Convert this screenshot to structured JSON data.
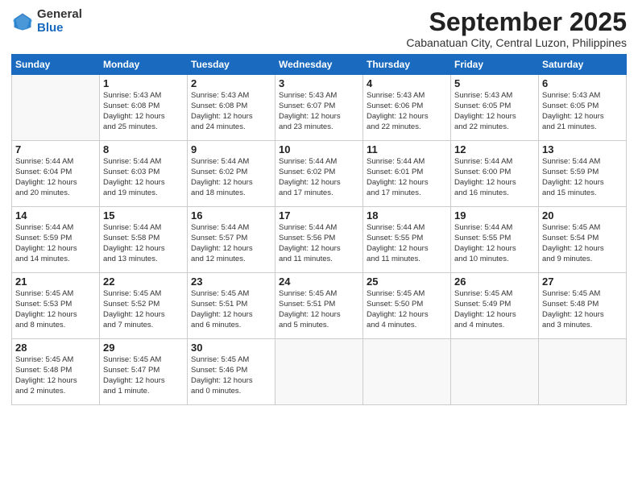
{
  "logo": {
    "general": "General",
    "blue": "Blue"
  },
  "header": {
    "month": "September 2025",
    "location": "Cabanatuan City, Central Luzon, Philippines"
  },
  "weekdays": [
    "Sunday",
    "Monday",
    "Tuesday",
    "Wednesday",
    "Thursday",
    "Friday",
    "Saturday"
  ],
  "weeks": [
    [
      {
        "day": "",
        "info": ""
      },
      {
        "day": "1",
        "info": "Sunrise: 5:43 AM\nSunset: 6:08 PM\nDaylight: 12 hours\nand 25 minutes."
      },
      {
        "day": "2",
        "info": "Sunrise: 5:43 AM\nSunset: 6:08 PM\nDaylight: 12 hours\nand 24 minutes."
      },
      {
        "day": "3",
        "info": "Sunrise: 5:43 AM\nSunset: 6:07 PM\nDaylight: 12 hours\nand 23 minutes."
      },
      {
        "day": "4",
        "info": "Sunrise: 5:43 AM\nSunset: 6:06 PM\nDaylight: 12 hours\nand 22 minutes."
      },
      {
        "day": "5",
        "info": "Sunrise: 5:43 AM\nSunset: 6:05 PM\nDaylight: 12 hours\nand 22 minutes."
      },
      {
        "day": "6",
        "info": "Sunrise: 5:43 AM\nSunset: 6:05 PM\nDaylight: 12 hours\nand 21 minutes."
      }
    ],
    [
      {
        "day": "7",
        "info": "Sunrise: 5:44 AM\nSunset: 6:04 PM\nDaylight: 12 hours\nand 20 minutes."
      },
      {
        "day": "8",
        "info": "Sunrise: 5:44 AM\nSunset: 6:03 PM\nDaylight: 12 hours\nand 19 minutes."
      },
      {
        "day": "9",
        "info": "Sunrise: 5:44 AM\nSunset: 6:02 PM\nDaylight: 12 hours\nand 18 minutes."
      },
      {
        "day": "10",
        "info": "Sunrise: 5:44 AM\nSunset: 6:02 PM\nDaylight: 12 hours\nand 17 minutes."
      },
      {
        "day": "11",
        "info": "Sunrise: 5:44 AM\nSunset: 6:01 PM\nDaylight: 12 hours\nand 17 minutes."
      },
      {
        "day": "12",
        "info": "Sunrise: 5:44 AM\nSunset: 6:00 PM\nDaylight: 12 hours\nand 16 minutes."
      },
      {
        "day": "13",
        "info": "Sunrise: 5:44 AM\nSunset: 5:59 PM\nDaylight: 12 hours\nand 15 minutes."
      }
    ],
    [
      {
        "day": "14",
        "info": "Sunrise: 5:44 AM\nSunset: 5:59 PM\nDaylight: 12 hours\nand 14 minutes."
      },
      {
        "day": "15",
        "info": "Sunrise: 5:44 AM\nSunset: 5:58 PM\nDaylight: 12 hours\nand 13 minutes."
      },
      {
        "day": "16",
        "info": "Sunrise: 5:44 AM\nSunset: 5:57 PM\nDaylight: 12 hours\nand 12 minutes."
      },
      {
        "day": "17",
        "info": "Sunrise: 5:44 AM\nSunset: 5:56 PM\nDaylight: 12 hours\nand 11 minutes."
      },
      {
        "day": "18",
        "info": "Sunrise: 5:44 AM\nSunset: 5:55 PM\nDaylight: 12 hours\nand 11 minutes."
      },
      {
        "day": "19",
        "info": "Sunrise: 5:44 AM\nSunset: 5:55 PM\nDaylight: 12 hours\nand 10 minutes."
      },
      {
        "day": "20",
        "info": "Sunrise: 5:45 AM\nSunset: 5:54 PM\nDaylight: 12 hours\nand 9 minutes."
      }
    ],
    [
      {
        "day": "21",
        "info": "Sunrise: 5:45 AM\nSunset: 5:53 PM\nDaylight: 12 hours\nand 8 minutes."
      },
      {
        "day": "22",
        "info": "Sunrise: 5:45 AM\nSunset: 5:52 PM\nDaylight: 12 hours\nand 7 minutes."
      },
      {
        "day": "23",
        "info": "Sunrise: 5:45 AM\nSunset: 5:51 PM\nDaylight: 12 hours\nand 6 minutes."
      },
      {
        "day": "24",
        "info": "Sunrise: 5:45 AM\nSunset: 5:51 PM\nDaylight: 12 hours\nand 5 minutes."
      },
      {
        "day": "25",
        "info": "Sunrise: 5:45 AM\nSunset: 5:50 PM\nDaylight: 12 hours\nand 4 minutes."
      },
      {
        "day": "26",
        "info": "Sunrise: 5:45 AM\nSunset: 5:49 PM\nDaylight: 12 hours\nand 4 minutes."
      },
      {
        "day": "27",
        "info": "Sunrise: 5:45 AM\nSunset: 5:48 PM\nDaylight: 12 hours\nand 3 minutes."
      }
    ],
    [
      {
        "day": "28",
        "info": "Sunrise: 5:45 AM\nSunset: 5:48 PM\nDaylight: 12 hours\nand 2 minutes."
      },
      {
        "day": "29",
        "info": "Sunrise: 5:45 AM\nSunset: 5:47 PM\nDaylight: 12 hours\nand 1 minute."
      },
      {
        "day": "30",
        "info": "Sunrise: 5:45 AM\nSunset: 5:46 PM\nDaylight: 12 hours\nand 0 minutes."
      },
      {
        "day": "",
        "info": ""
      },
      {
        "day": "",
        "info": ""
      },
      {
        "day": "",
        "info": ""
      },
      {
        "day": "",
        "info": ""
      }
    ]
  ]
}
